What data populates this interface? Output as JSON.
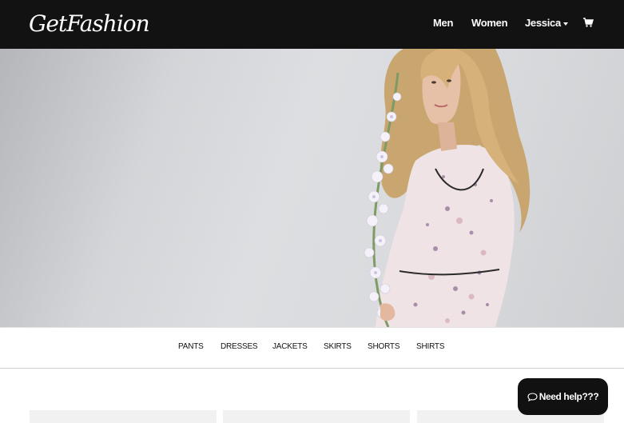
{
  "navbar": {
    "logo": "GetFashion",
    "links": {
      "men": "Men",
      "women": "Women",
      "user": "Jessica"
    },
    "cart_icon": "shopping-cart-icon"
  },
  "hero": {
    "image": "model-in-floral-dress-holding-flowers"
  },
  "categories": [
    "PANTS",
    "DRESSES",
    "JACKETS",
    "SKIRTS",
    "SHORTS",
    "SHIRTS"
  ],
  "help": {
    "label": "Need help???",
    "icon": "chat-bubble-icon"
  },
  "colors": {
    "navbar": "#121212",
    "hero_bg": "#d6d8db",
    "help_button": "#111111"
  }
}
